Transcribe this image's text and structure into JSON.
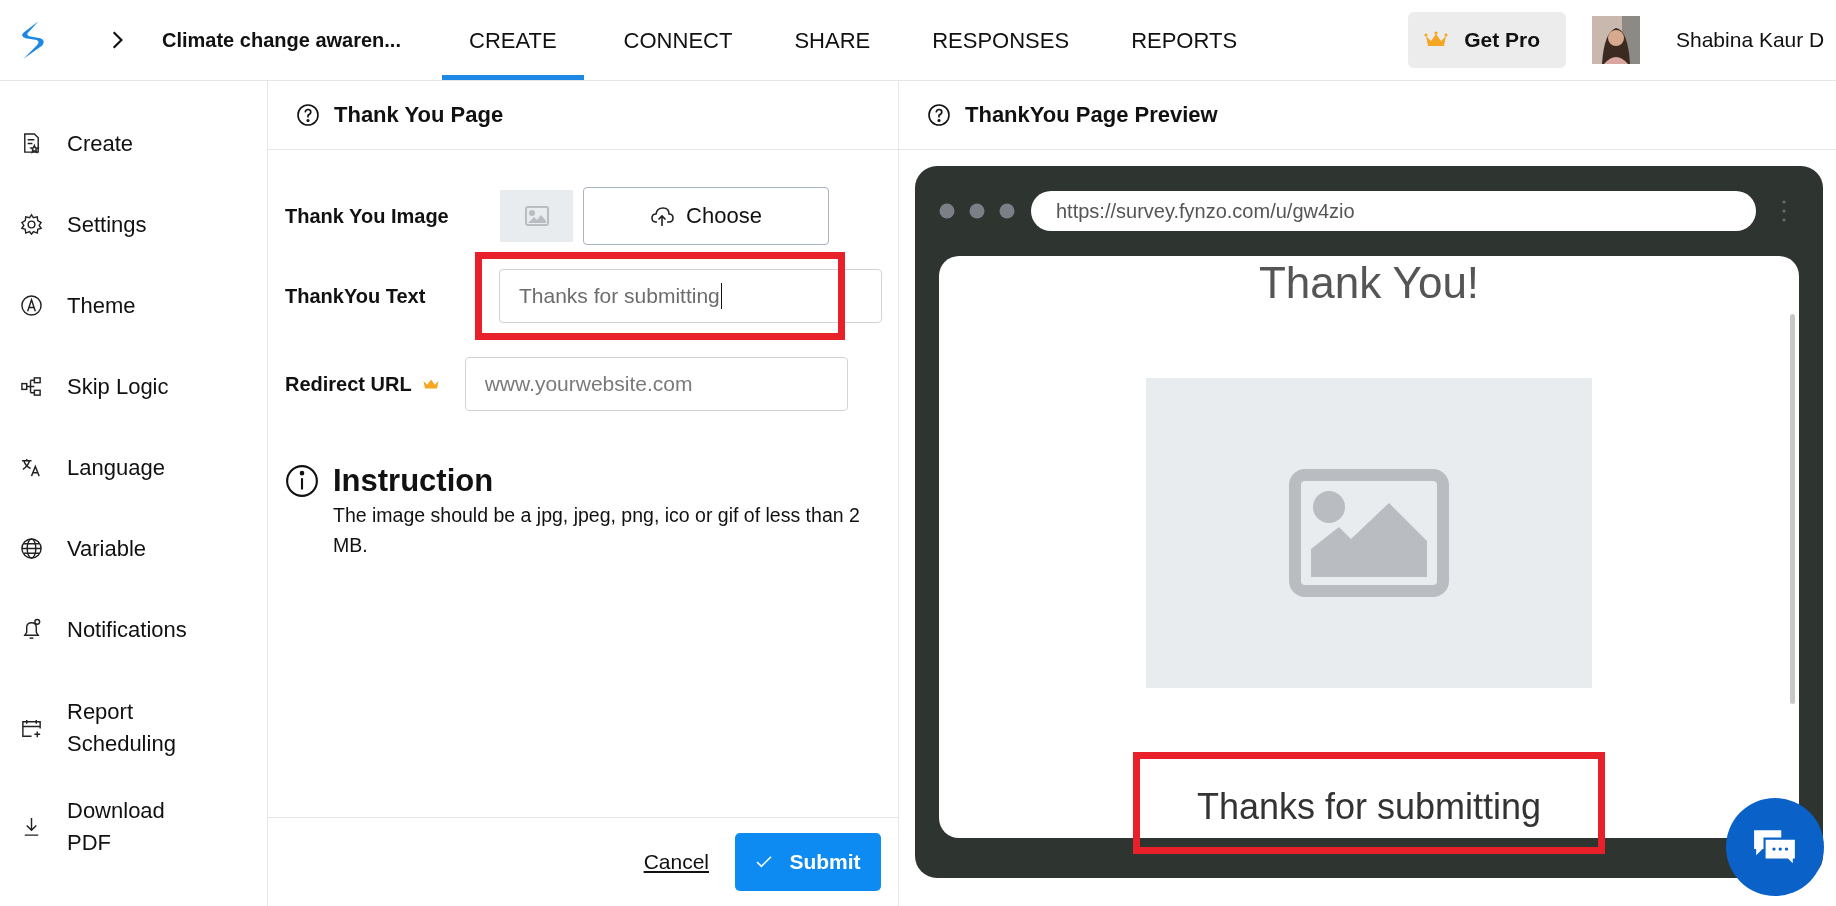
{
  "header": {
    "survey_title": "Climate change awaren...",
    "tabs": [
      {
        "label": "CREATE",
        "selected": true
      },
      {
        "label": "CONNECT",
        "selected": false
      },
      {
        "label": "SHARE",
        "selected": false
      },
      {
        "label": "RESPONSES",
        "selected": false
      },
      {
        "label": "REPORTS",
        "selected": false
      }
    ],
    "get_pro": "Get Pro",
    "user_name": "Shabina Kaur D"
  },
  "sidebar": {
    "items": [
      {
        "label": "Create"
      },
      {
        "label": "Settings"
      },
      {
        "label": "Theme"
      },
      {
        "label": "Skip Logic"
      },
      {
        "label": "Language"
      },
      {
        "label": "Variable"
      },
      {
        "label": "Notifications"
      },
      {
        "label": "Report Scheduling"
      },
      {
        "label": "Download PDF"
      }
    ]
  },
  "editor": {
    "title": "Thank You Page",
    "image_label": "Thank You Image",
    "choose_button": "Choose",
    "text_label": "ThankYou Text",
    "text_value": "Thanks for submitting",
    "text_highlighted": true,
    "redirect_label": "Redirect URL",
    "redirect_placeholder": "www.yourwebsite.com",
    "instruction_title": "Instruction",
    "instruction_text": "The image should be a jpg, jpeg, png, ico or gif of less than 2 MB.",
    "cancel": "Cancel",
    "submit": "Submit"
  },
  "preview": {
    "title": "ThankYou Page Preview",
    "url": "https://survey.fynzo.com/u/gw4zio",
    "heading": "Thank You!",
    "message": "Thanks for submitting",
    "message_highlighted": true
  }
}
